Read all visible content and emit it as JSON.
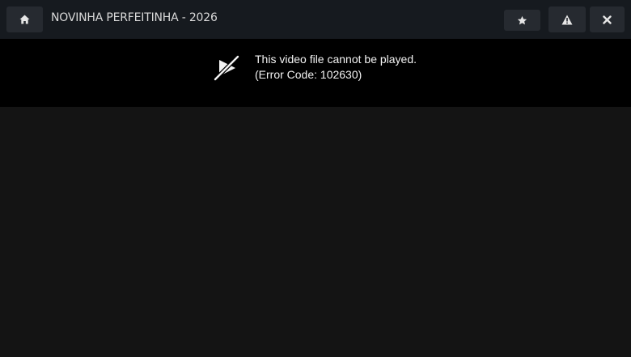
{
  "header": {
    "title": "NOVINHA PERFEITINHA - 2026",
    "buttons": {
      "home_icon": "home-icon",
      "favorite_icon": "star-icon",
      "report_icon": "warning-triangle-icon",
      "close_icon": "close-icon"
    }
  },
  "player": {
    "error_icon": "video-unavailable-icon",
    "error_message": "This video file cannot be played.",
    "error_code": "(Error Code: 102630)"
  },
  "colors": {
    "header_bg": "#161a1f",
    "button_bg": "#262a30",
    "error_bg": "#000000",
    "video_bg": "#141414",
    "text": "#f2f2f2"
  }
}
